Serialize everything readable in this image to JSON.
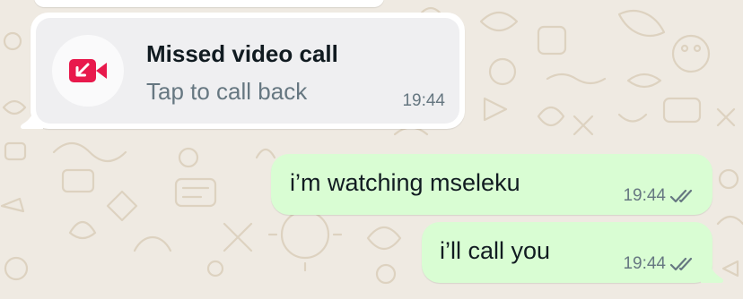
{
  "missed_call": {
    "title": "Missed video call",
    "subtitle": "Tap to call back",
    "time": "19:44",
    "icon": "missed-video-call-icon",
    "icon_color": "#e8194c"
  },
  "messages": [
    {
      "text": "i’m watching mseleku",
      "time": "19:44",
      "status_icon": "double-check-icon"
    },
    {
      "text": "i’ll call you",
      "time": "19:44",
      "status_icon": "double-check-icon"
    }
  ],
  "colors": {
    "wallpaper": "#efeae2",
    "incoming_bubble": "#ffffff",
    "outgoing_bubble": "#d9fdd3",
    "tick_gray": "#667781"
  }
}
